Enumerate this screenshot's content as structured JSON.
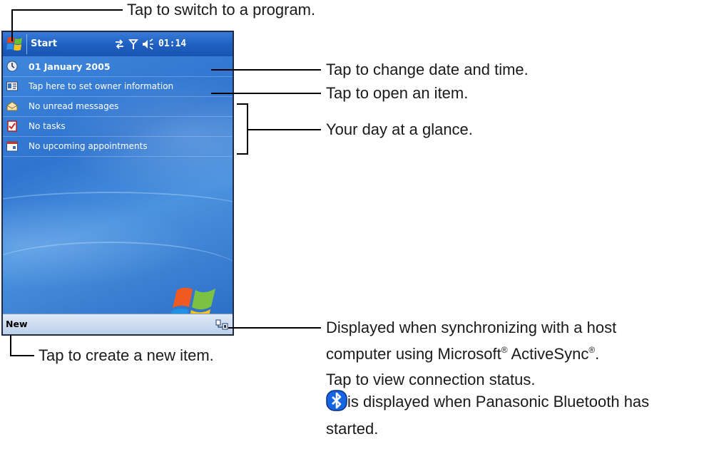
{
  "device": {
    "title_bar": {
      "start_label": "Start",
      "clock": "01:14",
      "icons": [
        "start-flag-icon",
        "connectivity-icon",
        "antenna-icon",
        "speaker-icon"
      ]
    },
    "today_items": [
      {
        "name": "date-item",
        "icon": "clock-icon",
        "text": "01 January 2005",
        "bold": true
      },
      {
        "name": "owner-item",
        "icon": "owner-card-icon",
        "text": "Tap here to set owner information"
      },
      {
        "name": "messages-item",
        "icon": "inbox-icon",
        "text": "No unread messages"
      },
      {
        "name": "tasks-item",
        "icon": "tasks-icon",
        "text": "No tasks"
      },
      {
        "name": "appointments-item",
        "icon": "calendar-icon",
        "text": "No upcoming appointments"
      }
    ],
    "menu_bar": {
      "new_label": "New",
      "sync_icon": "activesync-icon"
    }
  },
  "callouts": {
    "start": "Tap to switch to a program.",
    "date": "Tap to change date and time.",
    "open_item": "Tap to open an item.",
    "glance": "Your day at a glance.",
    "new_item": "Tap to create a new item.",
    "sync_line1_a": "Displayed when synchronizing with a host",
    "sync_line2_a": "computer using Microsoft",
    "sync_line2_reg1": "®",
    "sync_line2_b": " ActiveSync",
    "sync_line2_reg2": "®",
    "sync_line2_c": ".",
    "sync_line3": "Tap to view connection status.",
    "bluetooth_line1": " is displayed when Panasonic Bluetooth has",
    "bluetooth_line2": "started."
  },
  "colors": {
    "title_bar": "#1d5fc0",
    "today_background": "#2f74cf",
    "menu_bar": "#c8d8ee",
    "bluetooth_blue": "#1565e0"
  }
}
